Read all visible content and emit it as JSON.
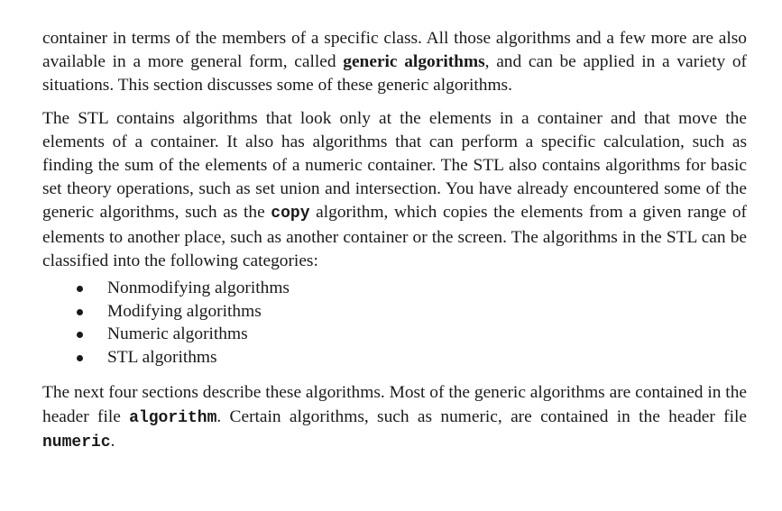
{
  "paragraphs": {
    "p1": {
      "part1": "container in terms of the members of a specific class. All those algorithms and a few more are also available in a more general form, called ",
      "bold": "generic algorithms",
      "part2": ", and can be applied in a variety of situations. This section discusses some of these generic algorithms."
    },
    "p2": {
      "part1": "The STL contains algorithms that look only at the elements in a container and that move the elements of a container. It also has algorithms that can perform a specific calculation, such as finding the sum of the elements of a numeric container. The STL also contains algorithms for basic set theory operations, such as set union and intersection. You have already encountered some of the generic algorithms, such as the ",
      "code": "copy",
      "part2": " algorithm, which copies the elements from a given range of elements to another place, such as another container or the screen. The algorithms in the STL can be classified into the following categories:"
    },
    "p3": {
      "part1": "The next four sections describe these algorithms. Most of the generic algorithms are contained in the header file ",
      "code1": "algorithm",
      "part2": ". Certain algorithms, such as numeric, are contained in the header file ",
      "code2": "numeric",
      "part3": "."
    }
  },
  "categories": [
    "Nonmodifying algorithms",
    "Modifying algorithms",
    "Numeric algorithms",
    "STL algorithms"
  ]
}
